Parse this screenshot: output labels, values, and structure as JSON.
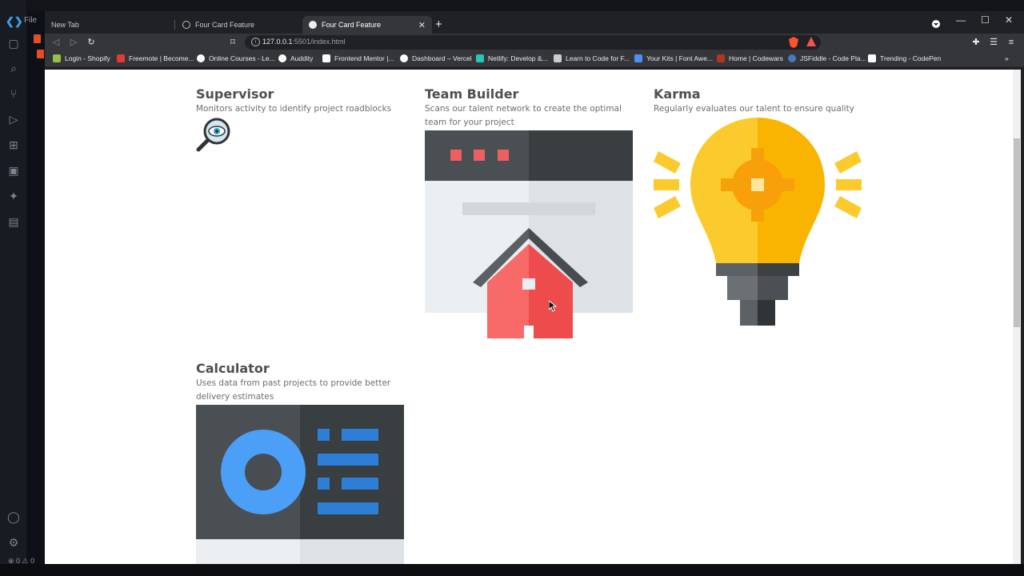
{
  "editor": {
    "menu_file": "File",
    "status": "⊗ 0 ⚠ 0"
  },
  "browser": {
    "tabs": [
      {
        "label": "New Tab"
      },
      {
        "label": "Four Card Feature"
      },
      {
        "label": "Four Card Feature"
      }
    ],
    "url_host": "127.0.0.1",
    "url_path": ":5501/index.html",
    "bookmarks": [
      {
        "label": "Login - Shopify",
        "color": "#95bf47"
      },
      {
        "label": "Freemote | Become...",
        "color": "#e53935"
      },
      {
        "label": "Online Courses - Le...",
        "color": "#ffffff"
      },
      {
        "label": "Auddity",
        "color": "#ffffff"
      },
      {
        "label": "Frontend Mentor |...",
        "color": "#ffffff"
      },
      {
        "label": "Dashboard – Vercel",
        "color": "#ffffff"
      },
      {
        "label": "Netlify: Develop &...",
        "color": "#25c7b7"
      },
      {
        "label": "Learn to Code for F...",
        "color": "#cccccc"
      },
      {
        "label": "Your Kits | Font Awe...",
        "color": "#4d8ff5"
      },
      {
        "label": "Home | Codewars",
        "color": "#b1361e"
      },
      {
        "label": "JSFiddle - Code Pla...",
        "color": "#4679bd"
      },
      {
        "label": "Trending - CodePen",
        "color": "#ffffff"
      }
    ]
  },
  "cards": [
    {
      "title": "Supervisor",
      "description": "Monitors activity to identify project roadblocks"
    },
    {
      "title": "Team Builder",
      "description": "Scans our talent network to create the optimal team for your project"
    },
    {
      "title": "Karma",
      "description": "Regularly evaluates our talent to ensure quality"
    },
    {
      "title": "Calculator",
      "description": "Uses data from past projects to provide better delivery estimates"
    }
  ],
  "colors": {
    "heading": "#4d4f52",
    "body": "#6b6d70",
    "red": "#f05f5f",
    "yellow": "#fbcb2e",
    "blue": "#4b9ff7"
  }
}
